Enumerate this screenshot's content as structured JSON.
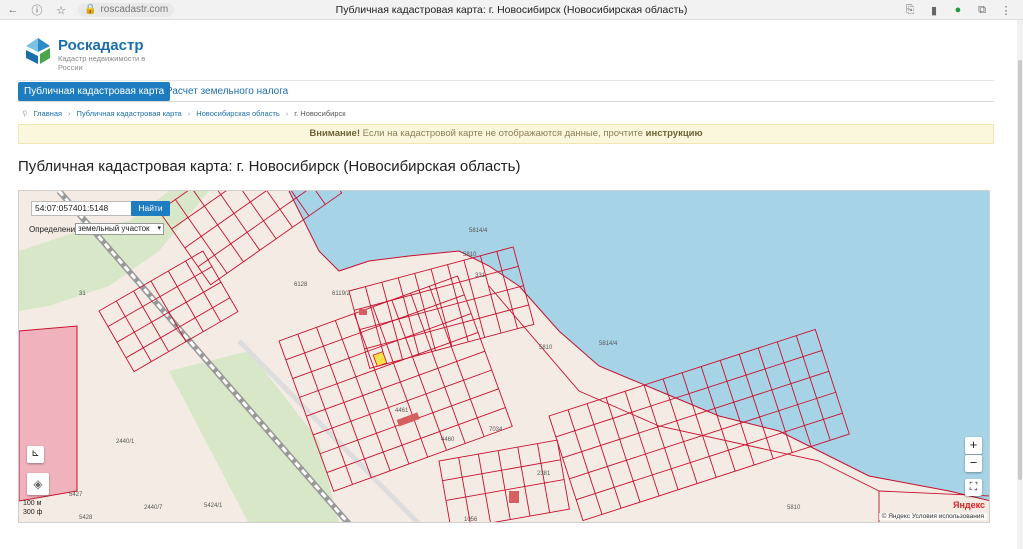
{
  "browser": {
    "url": "roscadastr.com",
    "title": "Публичная кадастровая карта: г. Новосибирск (Новосибирская область)"
  },
  "logo": {
    "name": "Роскадастр",
    "subtitle": "Кадастр недвижимости в России"
  },
  "nav": {
    "tabs": [
      {
        "label": "Публичная кадастровая карта",
        "active": true
      },
      {
        "label": "Расчет земельного налога",
        "active": false
      }
    ]
  },
  "breadcrumb": [
    "Главная",
    "Публичная кадастровая карта",
    "Новосибирская область",
    "г. Новосибирск"
  ],
  "notice": {
    "prefix": "Внимание!",
    "text": " Если на кадастровой карте не отображаются данные, прочтите ",
    "link": "инструкцию"
  },
  "page_title": "Публичная кадастровая карта: г. Новосибирск (Новосибирская область)",
  "map": {
    "search_value": "54:07:057401:5148",
    "find_label": "Найти",
    "define_label": "Определение:",
    "define_value": "земельный участок",
    "zoom_in": "+",
    "zoom_out": "−",
    "fullscreen": "⛶",
    "scale_top": "100 м",
    "scale_bottom": "300 ф",
    "copyright": "© Яндекс  Условия использования",
    "yandex": "Яндекс",
    "labels": [
      "5814/4",
      "5810",
      "6128",
      "6119/2",
      "31",
      "5810",
      "5814/4",
      "4461",
      "4460",
      "7034",
      "2381",
      "5427",
      "5428",
      "5424/1",
      "2440/7",
      "1056",
      "5810",
      "331",
      "2440/1"
    ],
    "colors": {
      "water": "#a7d3e6",
      "land": "#f4ece4",
      "border": "#c8102e",
      "green": "#cfe6c0",
      "selected": "#ffe24a"
    }
  }
}
